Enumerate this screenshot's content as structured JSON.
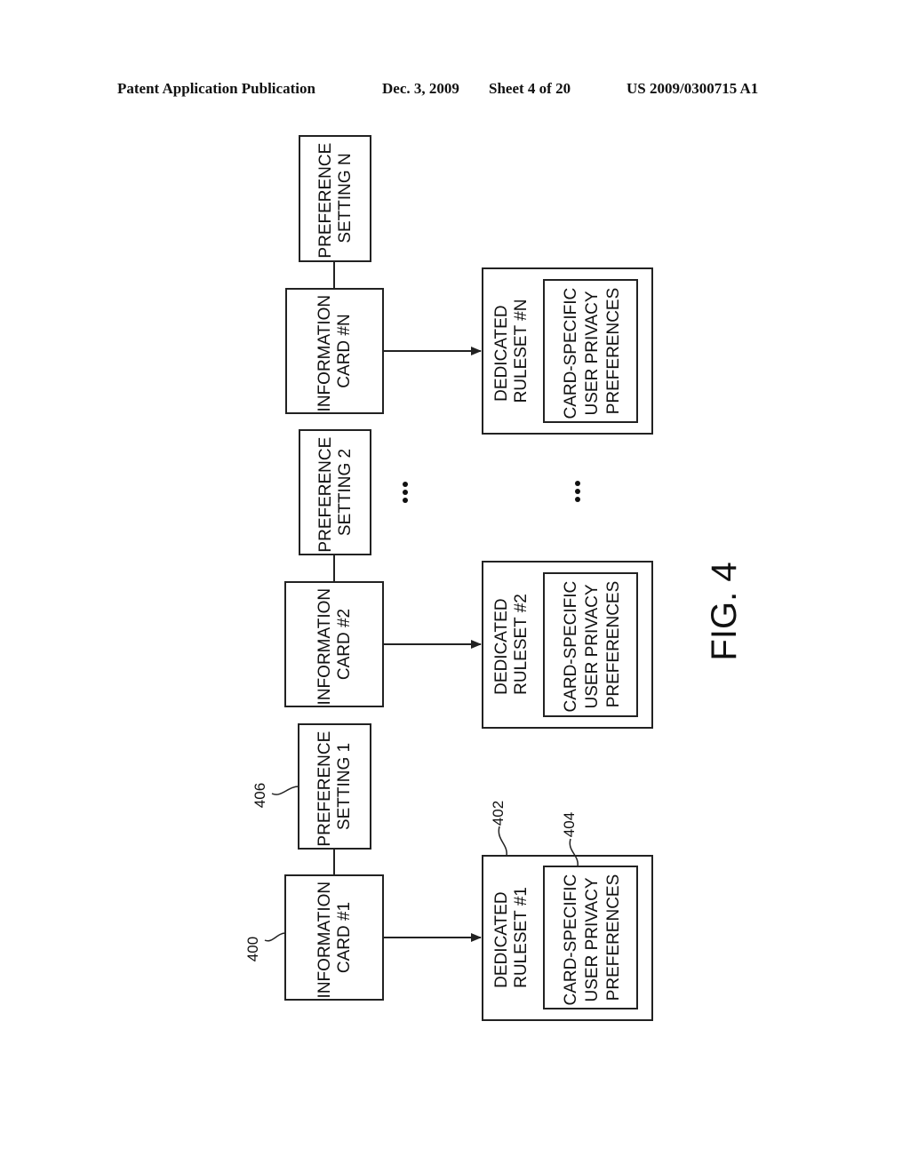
{
  "header": {
    "publication": "Patent Application Publication",
    "date": "Dec. 3, 2009",
    "sheet": "Sheet 4 of 20",
    "number": "US 2009/0300715 A1"
  },
  "figure": {
    "label": "FIG. 4",
    "ellipsis": "...",
    "columns": [
      {
        "card": [
          "INFORMATION",
          "CARD #1"
        ],
        "preference": [
          "PREFERENCE",
          "SETTING 1"
        ],
        "ruleset": [
          "DEDICATED",
          "RULESET #1"
        ],
        "inner": [
          "CARD-SPECIFIC",
          "USER PRIVACY",
          "PREFERENCES"
        ],
        "refs": {
          "card": "400",
          "preference": "406",
          "ruleset": "402",
          "inner": "404"
        }
      },
      {
        "card": [
          "INFORMATION",
          "CARD #2"
        ],
        "preference": [
          "PREFERENCE",
          "SETTING 2"
        ],
        "ruleset": [
          "DEDICATED",
          "RULESET #2"
        ],
        "inner": [
          "CARD-SPECIFIC",
          "USER PRIVACY",
          "PREFERENCES"
        ]
      },
      {
        "card": [
          "INFORMATION",
          "CARD #N"
        ],
        "preference": [
          "PREFERENCE",
          "SETTING N"
        ],
        "ruleset": [
          "DEDICATED",
          "RULESET #N"
        ],
        "inner": [
          "CARD-SPECIFIC",
          "USER PRIVACY",
          "PREFERENCES"
        ]
      }
    ]
  }
}
